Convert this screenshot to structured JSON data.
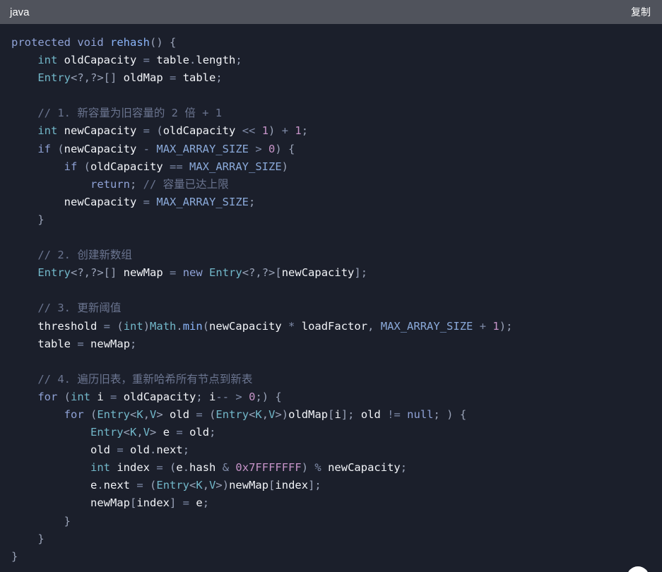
{
  "header": {
    "language": "java",
    "copy_label": "复制"
  },
  "code": {
    "lines": [
      [
        [
          "kw",
          "protected"
        ],
        [
          "pn",
          " "
        ],
        [
          "kw",
          "void"
        ],
        [
          "pn",
          " "
        ],
        [
          "fn",
          "rehash"
        ],
        [
          "pn",
          "() {"
        ]
      ],
      [
        [
          "pn",
          "    "
        ],
        [
          "tp",
          "int"
        ],
        [
          "pn",
          " "
        ],
        [
          "id",
          "oldCapacity"
        ],
        [
          "pn",
          " "
        ],
        [
          "op",
          "="
        ],
        [
          "pn",
          " "
        ],
        [
          "id",
          "table"
        ],
        [
          "pn",
          "."
        ],
        [
          "id",
          "length"
        ],
        [
          "pn",
          ";"
        ]
      ],
      [
        [
          "pn",
          "    "
        ],
        [
          "tp",
          "Entry"
        ],
        [
          "pn",
          "<?,?>[] "
        ],
        [
          "id",
          "oldMap"
        ],
        [
          "pn",
          " "
        ],
        [
          "op",
          "="
        ],
        [
          "pn",
          " "
        ],
        [
          "id",
          "table"
        ],
        [
          "pn",
          ";"
        ]
      ],
      [],
      [
        [
          "pn",
          "    "
        ],
        [
          "cm",
          "// 1. 新容量为旧容量的 2 倍 + 1"
        ]
      ],
      [
        [
          "pn",
          "    "
        ],
        [
          "tp",
          "int"
        ],
        [
          "pn",
          " "
        ],
        [
          "id",
          "newCapacity"
        ],
        [
          "pn",
          " "
        ],
        [
          "op",
          "="
        ],
        [
          "pn",
          " ("
        ],
        [
          "id",
          "oldCapacity"
        ],
        [
          "pn",
          " "
        ],
        [
          "op",
          "<<"
        ],
        [
          "pn",
          " "
        ],
        [
          "nm",
          "1"
        ],
        [
          "pn",
          ") "
        ],
        [
          "op",
          "+"
        ],
        [
          "pn",
          " "
        ],
        [
          "nm",
          "1"
        ],
        [
          "pn",
          ";"
        ]
      ],
      [
        [
          "pn",
          "    "
        ],
        [
          "kw",
          "if"
        ],
        [
          "pn",
          " ("
        ],
        [
          "id",
          "newCapacity"
        ],
        [
          "pn",
          " "
        ],
        [
          "op",
          "-"
        ],
        [
          "pn",
          " "
        ],
        [
          "cn",
          "MAX_ARRAY_SIZE"
        ],
        [
          "pn",
          " "
        ],
        [
          "op",
          ">"
        ],
        [
          "pn",
          " "
        ],
        [
          "nm",
          "0"
        ],
        [
          "pn",
          ") {"
        ]
      ],
      [
        [
          "pn",
          "        "
        ],
        [
          "kw",
          "if"
        ],
        [
          "pn",
          " ("
        ],
        [
          "id",
          "oldCapacity"
        ],
        [
          "pn",
          " "
        ],
        [
          "op",
          "=="
        ],
        [
          "pn",
          " "
        ],
        [
          "cn",
          "MAX_ARRAY_SIZE"
        ],
        [
          "pn",
          ")"
        ]
      ],
      [
        [
          "pn",
          "            "
        ],
        [
          "kw",
          "return"
        ],
        [
          "pn",
          "; "
        ],
        [
          "cm",
          "// 容量已达上限"
        ]
      ],
      [
        [
          "pn",
          "        "
        ],
        [
          "id",
          "newCapacity"
        ],
        [
          "pn",
          " "
        ],
        [
          "op",
          "="
        ],
        [
          "pn",
          " "
        ],
        [
          "cn",
          "MAX_ARRAY_SIZE"
        ],
        [
          "pn",
          ";"
        ]
      ],
      [
        [
          "pn",
          "    }"
        ]
      ],
      [],
      [
        [
          "pn",
          "    "
        ],
        [
          "cm",
          "// 2. 创建新数组"
        ]
      ],
      [
        [
          "pn",
          "    "
        ],
        [
          "tp",
          "Entry"
        ],
        [
          "pn",
          "<?,?>[] "
        ],
        [
          "id",
          "newMap"
        ],
        [
          "pn",
          " "
        ],
        [
          "op",
          "="
        ],
        [
          "pn",
          " "
        ],
        [
          "kw",
          "new"
        ],
        [
          "pn",
          " "
        ],
        [
          "tp",
          "Entry"
        ],
        [
          "pn",
          "<?,?>["
        ],
        [
          "id",
          "newCapacity"
        ],
        [
          "pn",
          "];"
        ]
      ],
      [],
      [
        [
          "pn",
          "    "
        ],
        [
          "cm",
          "// 3. 更新阈值"
        ]
      ],
      [
        [
          "pn",
          "    "
        ],
        [
          "id",
          "threshold"
        ],
        [
          "pn",
          " "
        ],
        [
          "op",
          "="
        ],
        [
          "pn",
          " ("
        ],
        [
          "tp",
          "int"
        ],
        [
          "pn",
          ")"
        ],
        [
          "tp",
          "Math"
        ],
        [
          "pn",
          "."
        ],
        [
          "fn",
          "min"
        ],
        [
          "pn",
          "("
        ],
        [
          "id",
          "newCapacity"
        ],
        [
          "pn",
          " "
        ],
        [
          "op",
          "*"
        ],
        [
          "pn",
          " "
        ],
        [
          "id",
          "loadFactor"
        ],
        [
          "pn",
          ", "
        ],
        [
          "cn",
          "MAX_ARRAY_SIZE"
        ],
        [
          "pn",
          " "
        ],
        [
          "op",
          "+"
        ],
        [
          "pn",
          " "
        ],
        [
          "nm",
          "1"
        ],
        [
          "pn",
          ");"
        ]
      ],
      [
        [
          "pn",
          "    "
        ],
        [
          "id",
          "table"
        ],
        [
          "pn",
          " "
        ],
        [
          "op",
          "="
        ],
        [
          "pn",
          " "
        ],
        [
          "id",
          "newMap"
        ],
        [
          "pn",
          ";"
        ]
      ],
      [],
      [
        [
          "pn",
          "    "
        ],
        [
          "cm",
          "// 4. 遍历旧表，重新哈希所有节点到新表"
        ]
      ],
      [
        [
          "pn",
          "    "
        ],
        [
          "kw",
          "for"
        ],
        [
          "pn",
          " ("
        ],
        [
          "tp",
          "int"
        ],
        [
          "pn",
          " "
        ],
        [
          "id",
          "i"
        ],
        [
          "pn",
          " "
        ],
        [
          "op",
          "="
        ],
        [
          "pn",
          " "
        ],
        [
          "id",
          "oldCapacity"
        ],
        [
          "pn",
          "; "
        ],
        [
          "id",
          "i"
        ],
        [
          "op",
          "--"
        ],
        [
          "pn",
          " "
        ],
        [
          "op",
          ">"
        ],
        [
          "pn",
          " "
        ],
        [
          "nm",
          "0"
        ],
        [
          "pn",
          ";) {"
        ]
      ],
      [
        [
          "pn",
          "        "
        ],
        [
          "kw",
          "for"
        ],
        [
          "pn",
          " ("
        ],
        [
          "tp",
          "Entry"
        ],
        [
          "pn",
          "<"
        ],
        [
          "tp",
          "K"
        ],
        [
          "pn",
          ","
        ],
        [
          "tp",
          "V"
        ],
        [
          "pn",
          "> "
        ],
        [
          "id",
          "old"
        ],
        [
          "pn",
          " "
        ],
        [
          "op",
          "="
        ],
        [
          "pn",
          " ("
        ],
        [
          "tp",
          "Entry"
        ],
        [
          "pn",
          "<"
        ],
        [
          "tp",
          "K"
        ],
        [
          "pn",
          ","
        ],
        [
          "tp",
          "V"
        ],
        [
          "pn",
          ">)"
        ],
        [
          "id",
          "oldMap"
        ],
        [
          "pn",
          "["
        ],
        [
          "id",
          "i"
        ],
        [
          "pn",
          "]; "
        ],
        [
          "id",
          "old"
        ],
        [
          "pn",
          " "
        ],
        [
          "op",
          "!="
        ],
        [
          "pn",
          " "
        ],
        [
          "kw",
          "null"
        ],
        [
          "pn",
          "; ) {"
        ]
      ],
      [
        [
          "pn",
          "            "
        ],
        [
          "tp",
          "Entry"
        ],
        [
          "pn",
          "<"
        ],
        [
          "tp",
          "K"
        ],
        [
          "pn",
          ","
        ],
        [
          "tp",
          "V"
        ],
        [
          "pn",
          "> "
        ],
        [
          "id",
          "e"
        ],
        [
          "pn",
          " "
        ],
        [
          "op",
          "="
        ],
        [
          "pn",
          " "
        ],
        [
          "id",
          "old"
        ],
        [
          "pn",
          ";"
        ]
      ],
      [
        [
          "pn",
          "            "
        ],
        [
          "id",
          "old"
        ],
        [
          "pn",
          " "
        ],
        [
          "op",
          "="
        ],
        [
          "pn",
          " "
        ],
        [
          "id",
          "old"
        ],
        [
          "pn",
          "."
        ],
        [
          "id",
          "next"
        ],
        [
          "pn",
          ";"
        ]
      ],
      [
        [
          "pn",
          "            "
        ],
        [
          "tp",
          "int"
        ],
        [
          "pn",
          " "
        ],
        [
          "id",
          "index"
        ],
        [
          "pn",
          " "
        ],
        [
          "op",
          "="
        ],
        [
          "pn",
          " ("
        ],
        [
          "id",
          "e"
        ],
        [
          "pn",
          "."
        ],
        [
          "id",
          "hash"
        ],
        [
          "pn",
          " "
        ],
        [
          "op",
          "&"
        ],
        [
          "pn",
          " "
        ],
        [
          "nm",
          "0x7FFFFFFF"
        ],
        [
          "pn",
          ") "
        ],
        [
          "op",
          "%"
        ],
        [
          "pn",
          " "
        ],
        [
          "id",
          "newCapacity"
        ],
        [
          "pn",
          ";"
        ]
      ],
      [
        [
          "pn",
          "            "
        ],
        [
          "id",
          "e"
        ],
        [
          "pn",
          "."
        ],
        [
          "id",
          "next"
        ],
        [
          "pn",
          " "
        ],
        [
          "op",
          "="
        ],
        [
          "pn",
          " ("
        ],
        [
          "tp",
          "Entry"
        ],
        [
          "pn",
          "<"
        ],
        [
          "tp",
          "K"
        ],
        [
          "pn",
          ","
        ],
        [
          "tp",
          "V"
        ],
        [
          "pn",
          ">)"
        ],
        [
          "id",
          "newMap"
        ],
        [
          "pn",
          "["
        ],
        [
          "id",
          "index"
        ],
        [
          "pn",
          "];"
        ]
      ],
      [
        [
          "pn",
          "            "
        ],
        [
          "id",
          "newMap"
        ],
        [
          "pn",
          "["
        ],
        [
          "id",
          "index"
        ],
        [
          "pn",
          "] "
        ],
        [
          "op",
          "="
        ],
        [
          "pn",
          " "
        ],
        [
          "id",
          "e"
        ],
        [
          "pn",
          ";"
        ]
      ],
      [
        [
          "pn",
          "        }"
        ]
      ],
      [
        [
          "pn",
          "    }"
        ]
      ],
      [
        [
          "pn",
          "}"
        ]
      ]
    ]
  },
  "colors": {
    "background": "#1b1f2b",
    "header_bg": "#50535c",
    "keyword": "#8fa2d6",
    "type": "#72b7c9",
    "identifier": "#f1f3f7",
    "comment": "#6b7590",
    "number": "#c794c8"
  }
}
